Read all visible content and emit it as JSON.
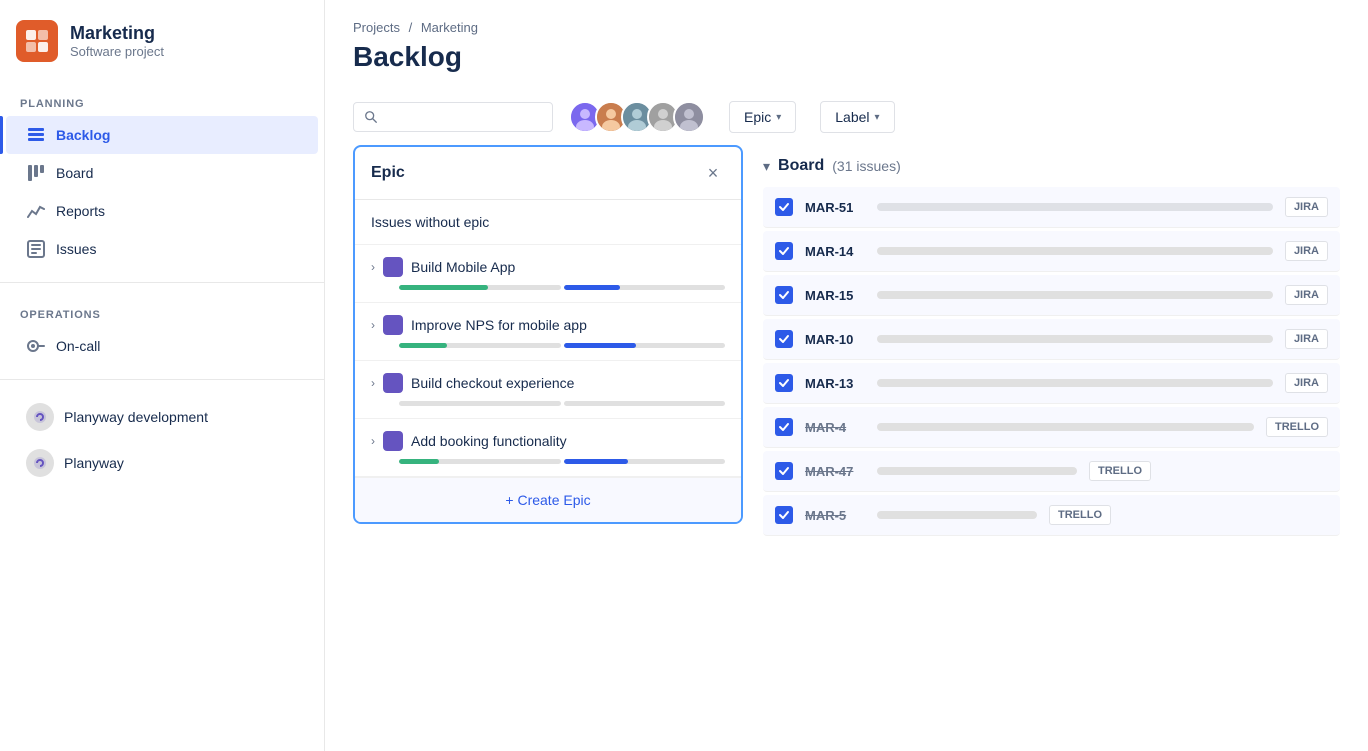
{
  "sidebar": {
    "logo_alt": "Marketing logo",
    "project_name": "Marketing",
    "project_sub": "Software project",
    "planning_label": "Planning",
    "operations_label": "Operations",
    "nav_items": [
      {
        "id": "backlog",
        "label": "Backlog",
        "icon": "backlog-icon",
        "active": true
      },
      {
        "id": "board",
        "label": "Board",
        "icon": "board-icon",
        "active": false
      },
      {
        "id": "reports",
        "label": "Reports",
        "icon": "reports-icon",
        "active": false
      },
      {
        "id": "issues",
        "label": "Issues",
        "icon": "issues-icon",
        "active": false
      }
    ],
    "ops_items": [
      {
        "id": "oncall",
        "label": "On-call",
        "icon": "oncall-icon"
      }
    ],
    "projects": [
      {
        "id": "planyway-dev",
        "label": "Planyway development"
      },
      {
        "id": "planyway",
        "label": "Planyway"
      }
    ]
  },
  "header": {
    "breadcrumb_projects": "Projects",
    "breadcrumb_sep": "/",
    "breadcrumb_marketing": "Marketing",
    "page_title": "Backlog"
  },
  "toolbar": {
    "search_placeholder": "",
    "filter_epic_label": "Epic",
    "filter_label_label": "Label"
  },
  "epic_panel": {
    "title": "Epic",
    "close_btn": "×",
    "no_epic_label": "Issues without epic",
    "items": [
      {
        "id": "build-mobile-app",
        "name": "Build Mobile App",
        "green_pct": 55,
        "blue_pct": 35
      },
      {
        "id": "improve-nps",
        "name": "Improve NPS for mobile app",
        "green_pct": 30,
        "blue_pct": 45
      },
      {
        "id": "build-checkout",
        "name": "Build checkout experience",
        "green_pct": 0,
        "blue_pct": 0
      },
      {
        "id": "add-booking",
        "name": "Add booking functionality",
        "green_pct": 25,
        "blue_pct": 40
      }
    ],
    "create_label": "+ Create Epic"
  },
  "board_section": {
    "title": "Board",
    "issue_count": "(31 issues)",
    "rows": [
      {
        "id": "MAR-51",
        "strikethrough": false,
        "tag": "JIRA",
        "tag_type": "jira"
      },
      {
        "id": "MAR-14",
        "strikethrough": false,
        "tag": "JIRA",
        "tag_type": "jira"
      },
      {
        "id": "MAR-15",
        "strikethrough": false,
        "tag": "JIRA",
        "tag_type": "jira"
      },
      {
        "id": "MAR-10",
        "strikethrough": false,
        "tag": "JIRA",
        "tag_type": "jira"
      },
      {
        "id": "MAR-13",
        "strikethrough": false,
        "tag": "JIRA",
        "tag_type": "jira"
      },
      {
        "id": "MAR-4",
        "strikethrough": true,
        "tag": "TRELLO",
        "tag_type": "trello"
      },
      {
        "id": "MAR-47",
        "strikethrough": true,
        "tag": "TRELLO",
        "tag_type": "trello"
      },
      {
        "id": "MAR-5",
        "strikethrough": true,
        "tag": "TRELLO",
        "tag_type": "trello"
      }
    ]
  }
}
